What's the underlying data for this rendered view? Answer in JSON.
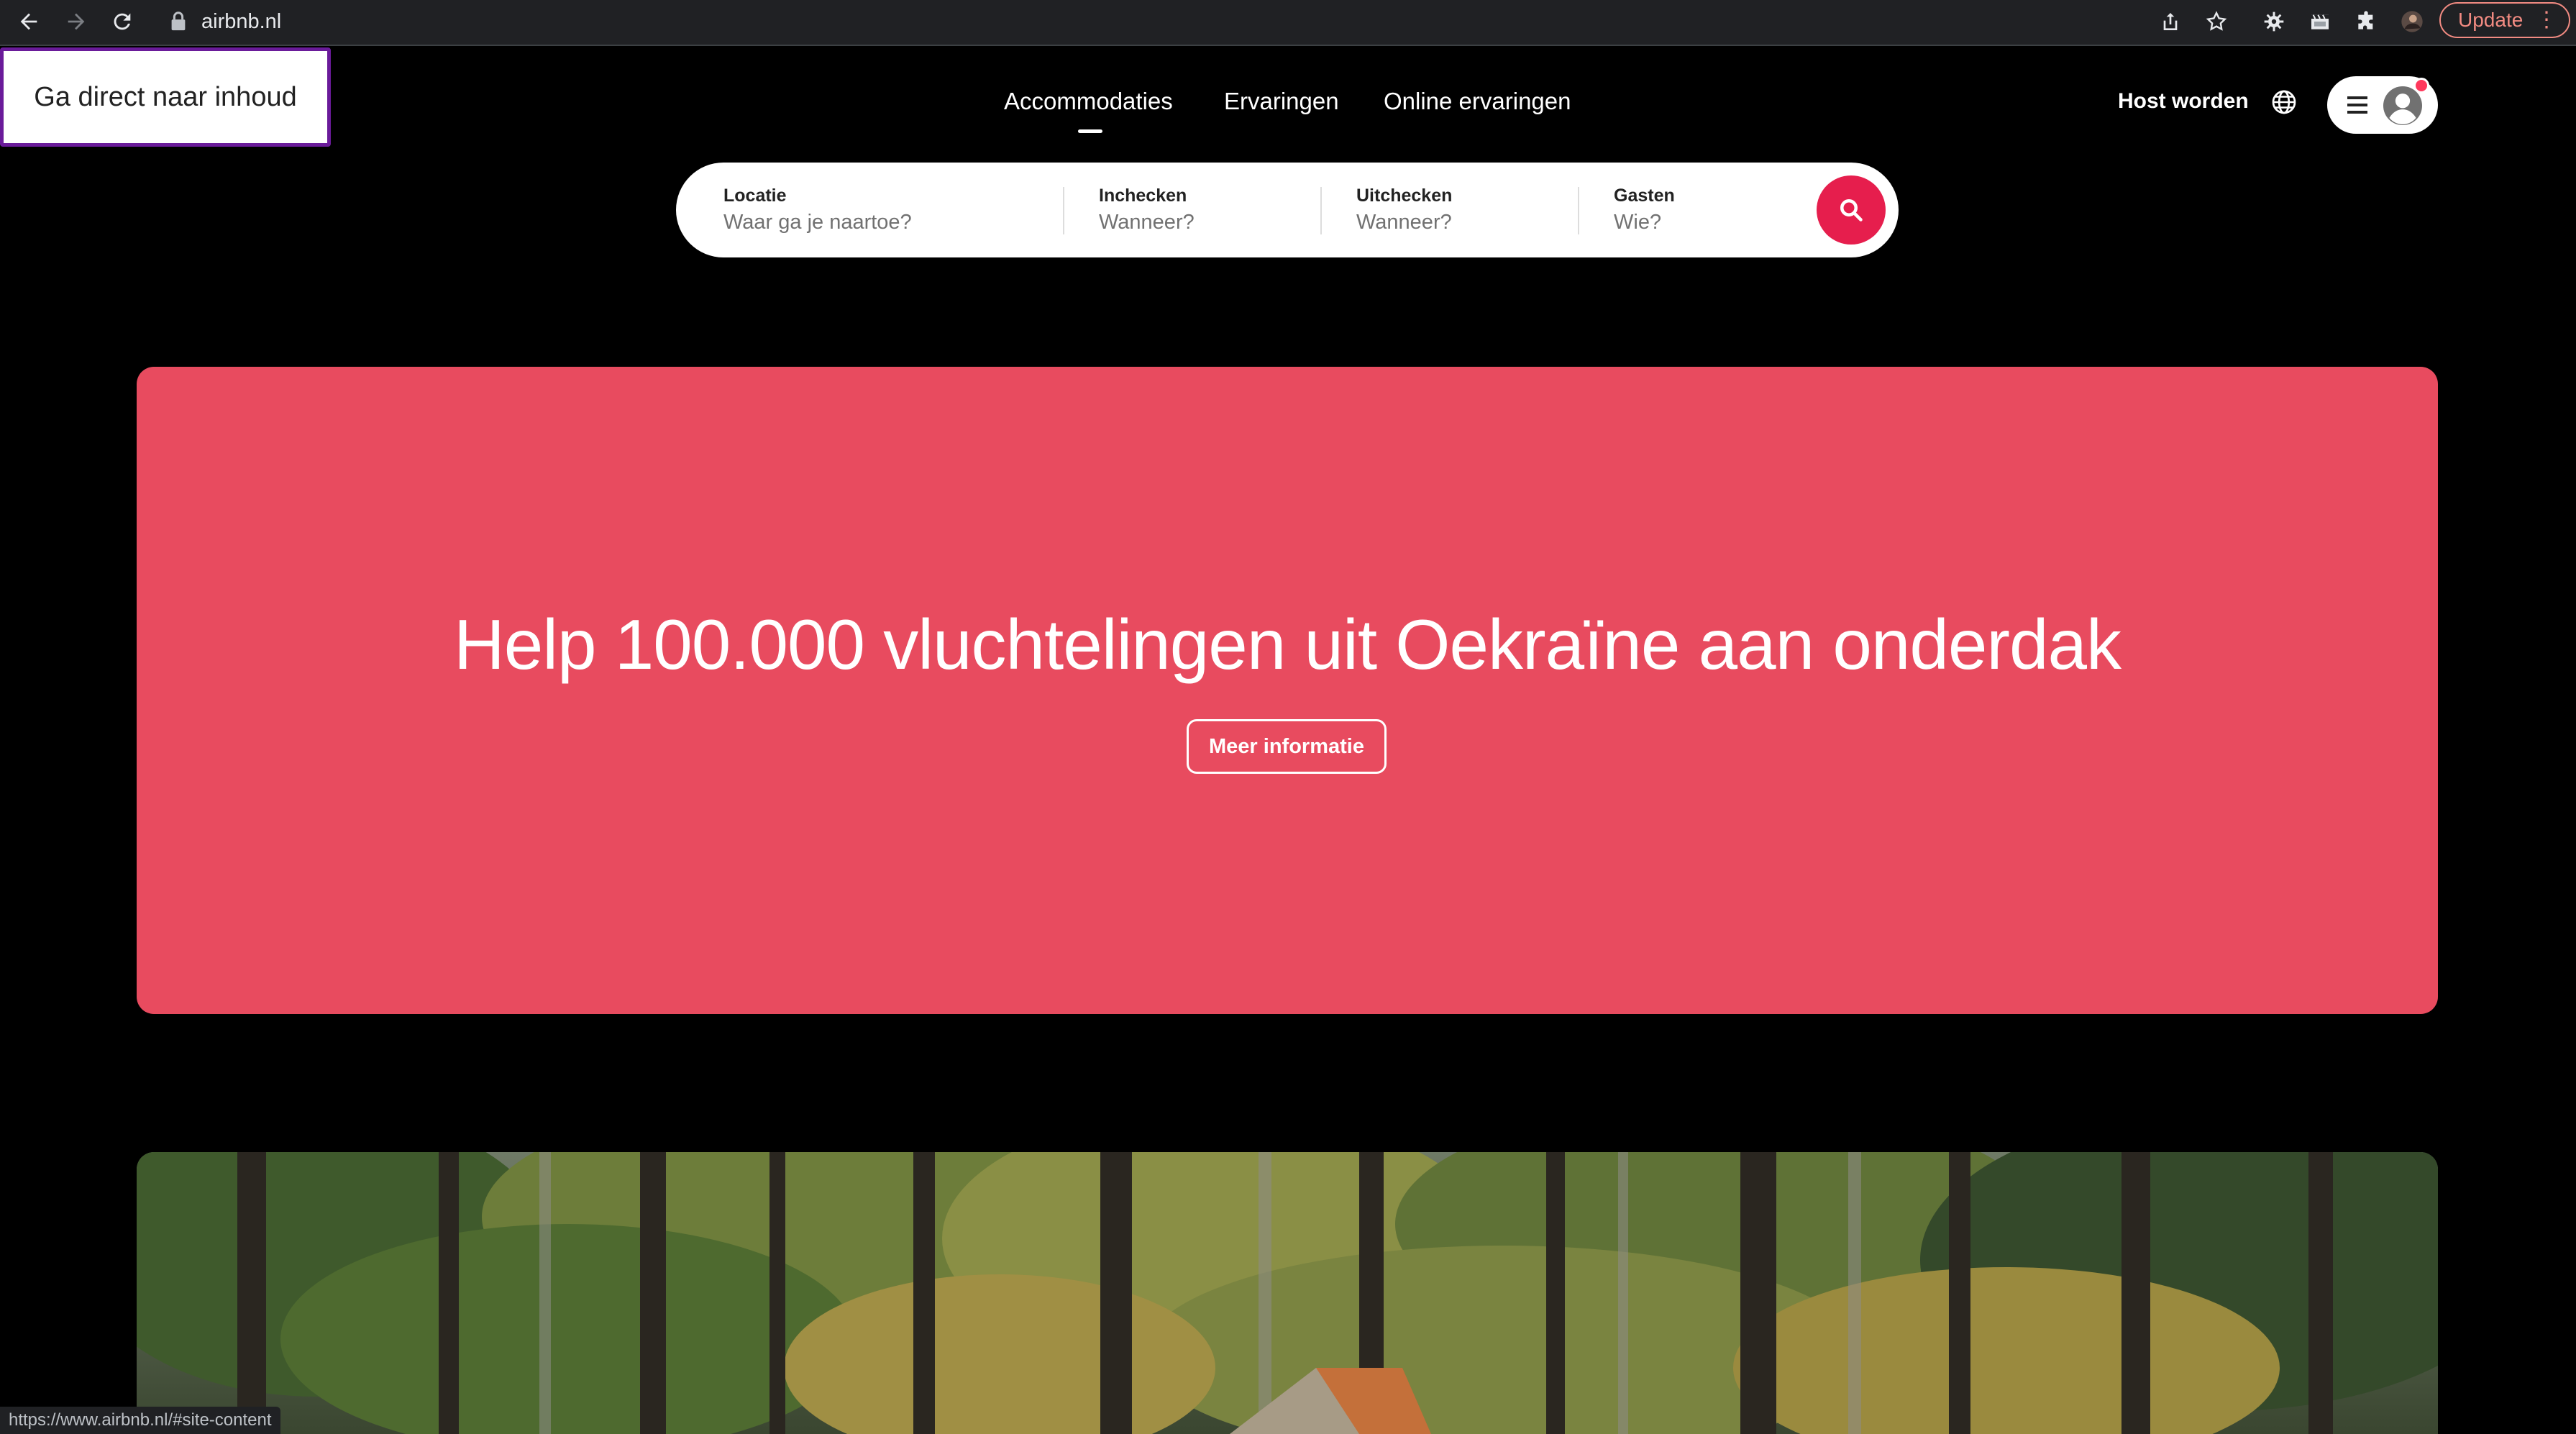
{
  "browser": {
    "url": "airbnb.nl",
    "update_label": "Update",
    "menu_glyph": "⋮",
    "status_url": "https://www.airbnb.nl/#site-content",
    "icons": [
      "back-arrow-icon",
      "forward-arrow-icon",
      "reload-icon",
      "lock-icon",
      "share-icon",
      "bookmark-star-icon",
      "extension-gear-icon",
      "extension-clapper-icon",
      "extensions-puzzle-icon",
      "profile-avatar-icon"
    ]
  },
  "skip_link": "Ga direct naar inhoud",
  "header": {
    "tabs": [
      {
        "label": "Accommodaties",
        "active": true
      },
      {
        "label": "Ervaringen",
        "active": false
      },
      {
        "label": "Online ervaringen",
        "active": false
      }
    ],
    "host_label": "Host worden",
    "icons": [
      "globe-icon",
      "hamburger-menu-icon",
      "user-avatar-icon"
    ],
    "notification_color": "#ff385c"
  },
  "search": {
    "fields": [
      {
        "label": "Locatie",
        "placeholder": "Waar ga je naartoe?"
      },
      {
        "label": "Inchecken",
        "placeholder": "Wanneer?"
      },
      {
        "label": "Uitchecken",
        "placeholder": "Wanneer?"
      },
      {
        "label": "Gasten",
        "placeholder": "Wie?"
      }
    ],
    "button_color": "#e61e4d",
    "button_icon": "search-icon"
  },
  "banner": {
    "title": "Help 100.000 vluchtelingen uit Oekraïne aan onderdak",
    "button_label": "Meer informatie",
    "background": "#e84b5f"
  },
  "hero": {
    "scene": "forest-with-cabin"
  }
}
